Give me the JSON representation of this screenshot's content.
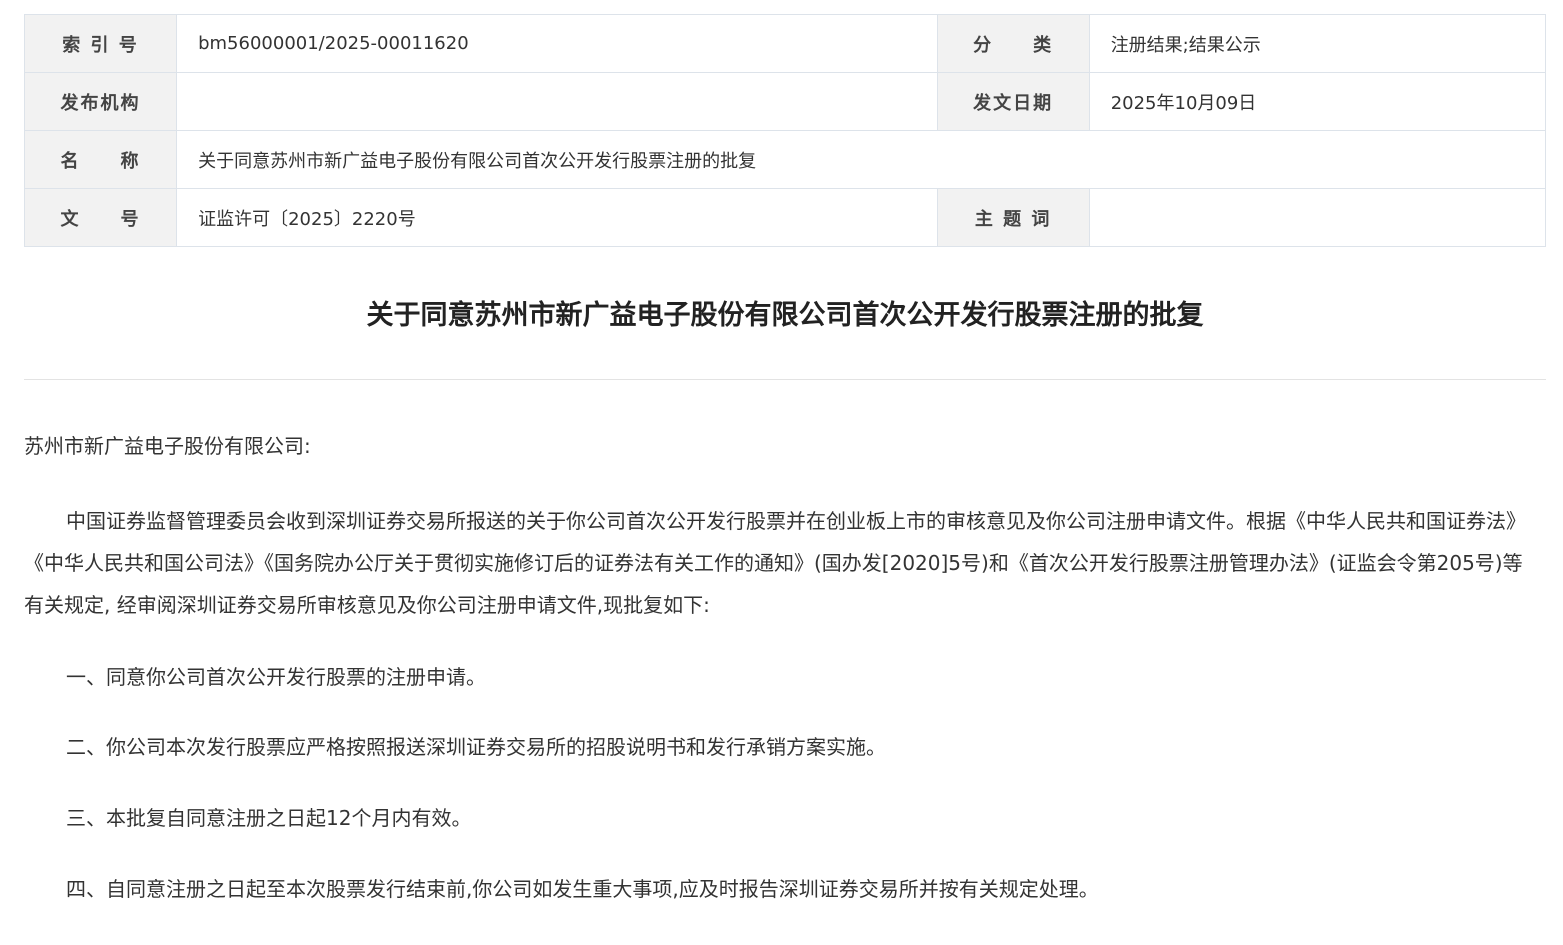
{
  "meta": {
    "index_label": "索 引 号",
    "index_value": "bm56000001/2025-00011620",
    "category_label": "分　　类",
    "category_value": "注册结果;结果公示",
    "publisher_label": "发布机构",
    "publisher_value": "",
    "date_label": "发文日期",
    "date_value": "2025年10月09日",
    "name_label": "名　　称",
    "name_value": "关于同意苏州市新广益电子股份有限公司首次公开发行股票注册的批复",
    "docno_label": "文　　号",
    "docno_value": "证监许可〔2025〕2220号",
    "keyword_label": "主 题 词",
    "keyword_value": ""
  },
  "document": {
    "title": "关于同意苏州市新广益电子股份有限公司首次公开发行股票注册的批复",
    "salutation": "苏州市新广益电子股份有限公司:",
    "intro": "中国证券监督管理委员会收到深圳证券交易所报送的关于你公司首次公开发行股票并在创业板上市的审核意见及你公司注册申请文件。根据《中华人民共和国证券法》《中华人民共和国公司法》《国务院办公厅关于贯彻实施修订后的证券法有关工作的通知》(国办发[2020]5号)和《首次公开发行股票注册管理办法》(证监会令第205号)等有关规定, 经审阅深圳证券交易所审核意见及你公司注册申请文件,现批复如下:",
    "items": [
      "一、同意你公司首次公开发行股票的注册申请。",
      "二、你公司本次发行股票应严格按照报送深圳证券交易所的招股说明书和发行承销方案实施。",
      "三、本批复自同意注册之日起12个月内有效。",
      "四、自同意注册之日起至本次股票发行结束前,你公司如发生重大事项,应及时报告深圳证券交易所并按有关规定处理。"
    ]
  }
}
